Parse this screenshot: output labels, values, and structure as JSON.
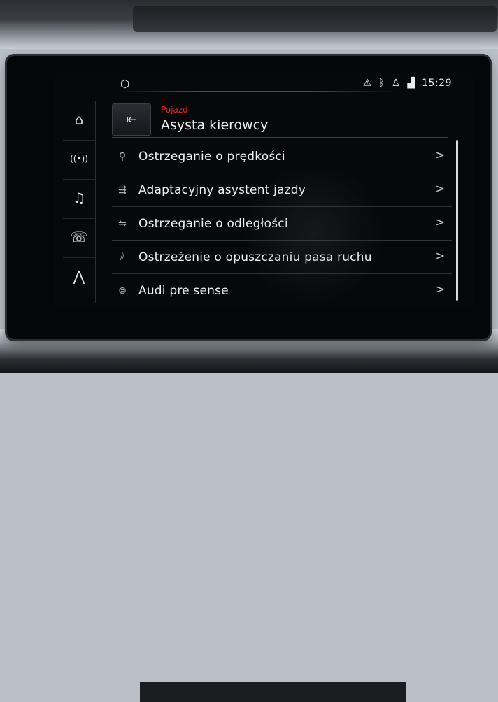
{
  "statusbar": {
    "home_icon": "cube-icon",
    "icons": [
      "car-warning-icon",
      "bluetooth-icon",
      "person-icon",
      "signal-icon"
    ],
    "time": "15:29"
  },
  "rail": {
    "items": [
      {
        "name": "home-icon",
        "glyph": "⌂"
      },
      {
        "name": "radio-icon",
        "glyph": "((•))"
      },
      {
        "name": "music-icon",
        "glyph": "♫"
      },
      {
        "name": "phone-icon",
        "glyph": "☏"
      },
      {
        "name": "navigation-icon",
        "glyph": "⋀"
      }
    ]
  },
  "header": {
    "back_icon": "back-icon",
    "breadcrumb": "Pojazd",
    "title": "Asysta kierowcy"
  },
  "list": {
    "items": [
      {
        "icon": "speed-warning-icon",
        "label": "Ostrzeganie o prędkości",
        "chevron": ">"
      },
      {
        "icon": "adaptive-cruise-icon",
        "label": "Adaptacyjny asystent jazdy",
        "chevron": ">"
      },
      {
        "icon": "distance-warning-icon",
        "label": "Ostrzeganie o odległości",
        "chevron": ">"
      },
      {
        "icon": "lane-departure-icon",
        "label": "Ostrzeżenie o opuszczaniu pasa ruchu",
        "chevron": ">"
      },
      {
        "icon": "pre-sense-icon",
        "label": "Audi pre sense",
        "chevron": ">"
      }
    ]
  },
  "colors": {
    "accent": "#e0262b",
    "screen_bg": "#07080a",
    "text": "#f1f2f4"
  }
}
